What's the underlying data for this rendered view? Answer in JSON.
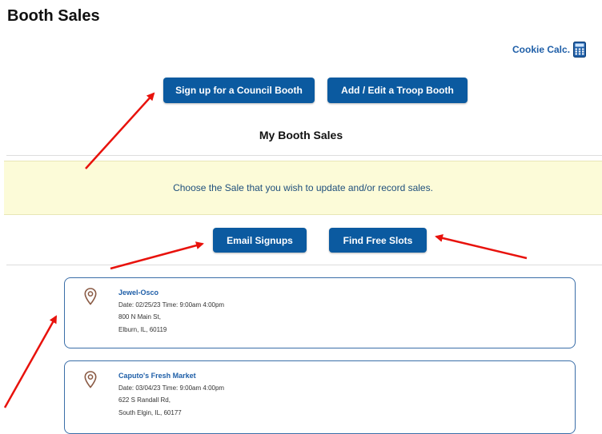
{
  "page": {
    "title": "Booth Sales",
    "cookie_calc_label": "Cookie Calc."
  },
  "actions": {
    "council_booth": "Sign up for a Council Booth",
    "troop_booth": "Add / Edit a Troop Booth",
    "email_signups": "Email Signups",
    "find_free_slots": "Find Free Slots"
  },
  "section": {
    "title": "My Booth Sales",
    "notice": "Choose the Sale that you wish to update and/or record sales."
  },
  "booths": [
    {
      "name": "Jewel-Osco",
      "date_time": "Date: 02/25/23   Time: 9:00am 4:00pm",
      "street": "800 N Main St,",
      "city": "Elburn, IL, 60119"
    },
    {
      "name": "Caputo's Fresh Market",
      "date_time": "Date: 03/04/23   Time: 9:00am 4:00pm",
      "street": "622 S Randall Rd,",
      "city": "South Elgin, IL, 60177"
    }
  ],
  "colors": {
    "button": "#0b5aa0",
    "link": "#1f5fa8",
    "notice_bg": "#fcfbd8",
    "arrow": "#e8120c"
  }
}
